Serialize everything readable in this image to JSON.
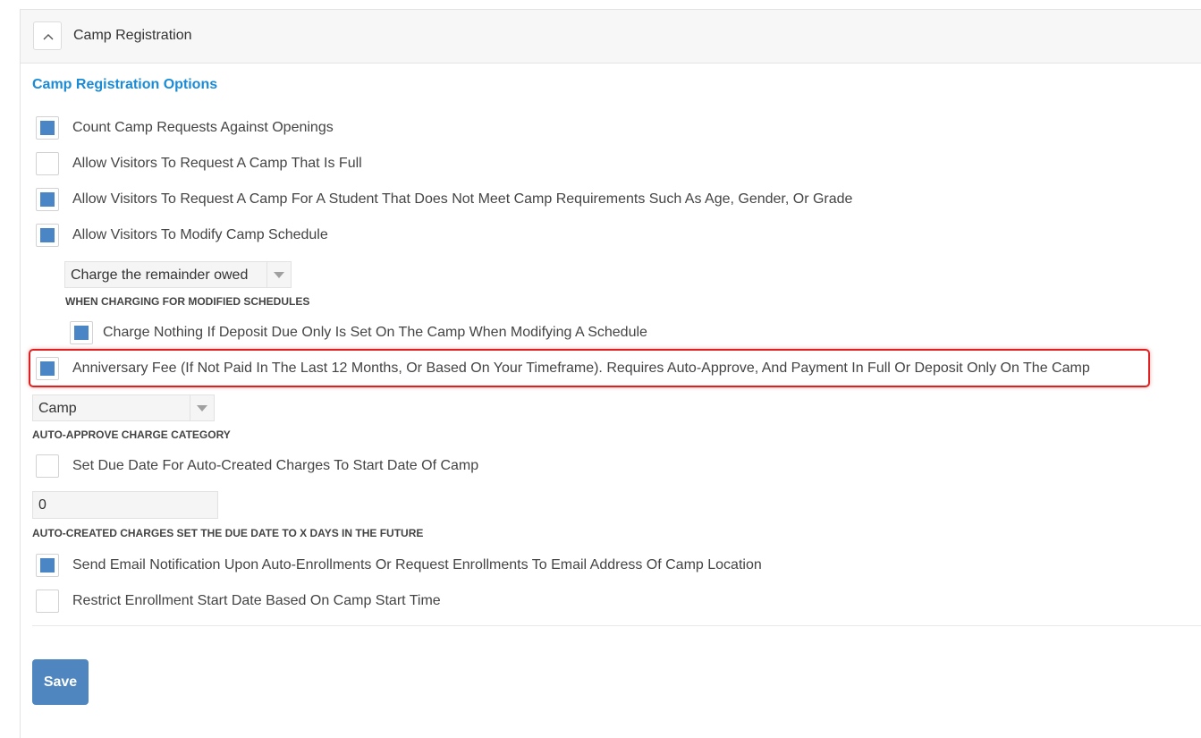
{
  "panel": {
    "title": "Camp Registration"
  },
  "section_title": "Camp Registration Options",
  "options": {
    "count_requests": {
      "label": "Count Camp Requests Against Openings",
      "checked": true
    },
    "allow_full": {
      "label": "Allow Visitors To Request A Camp That Is Full",
      "checked": false
    },
    "allow_requirements": {
      "label": "Allow Visitors To Request A Camp For A Student That Does Not Meet Camp Requirements Such As Age, Gender, Or Grade",
      "checked": true
    },
    "allow_modify": {
      "label": "Allow Visitors To Modify Camp Schedule",
      "checked": true
    },
    "charge_nothing": {
      "label": "Charge Nothing If Deposit Due Only Is Set On The Camp When Modifying A Schedule",
      "checked": true
    },
    "anniversary_fee": {
      "label": "Anniversary Fee (If Not Paid In The Last 12 Months, Or Based On Your Timeframe). Requires Auto-Approve, And Payment In Full Or Deposit Only On The Camp",
      "checked": true
    },
    "due_date_start": {
      "label": "Set Due Date For Auto-Created Charges To Start Date Of Camp",
      "checked": false
    },
    "send_email": {
      "label": "Send Email Notification Upon Auto-Enrollments Or Request Enrollments To Email Address Of Camp Location",
      "checked": true
    },
    "restrict_start": {
      "label": "Restrict Enrollment Start Date Based On Camp Start Time",
      "checked": false
    }
  },
  "modified_schedule_select": {
    "value": "Charge the remainder owed",
    "caption": "WHEN CHARGING FOR MODIFIED SCHEDULES"
  },
  "charge_category_select": {
    "value": "Camp",
    "caption": "AUTO-APPROVE CHARGE CATEGORY"
  },
  "due_days_input": {
    "value": "0",
    "caption": "AUTO-CREATED CHARGES SET THE DUE DATE TO X DAYS IN THE FUTURE"
  },
  "save_label": "Save",
  "colors": {
    "accent": "#1a8bd6",
    "checkbox": "#4a86c5",
    "button": "#4f86bf",
    "highlight": "#e02020"
  },
  "icons": {
    "collapse": "chevron-up-icon",
    "dropdown": "caret-down-icon"
  }
}
